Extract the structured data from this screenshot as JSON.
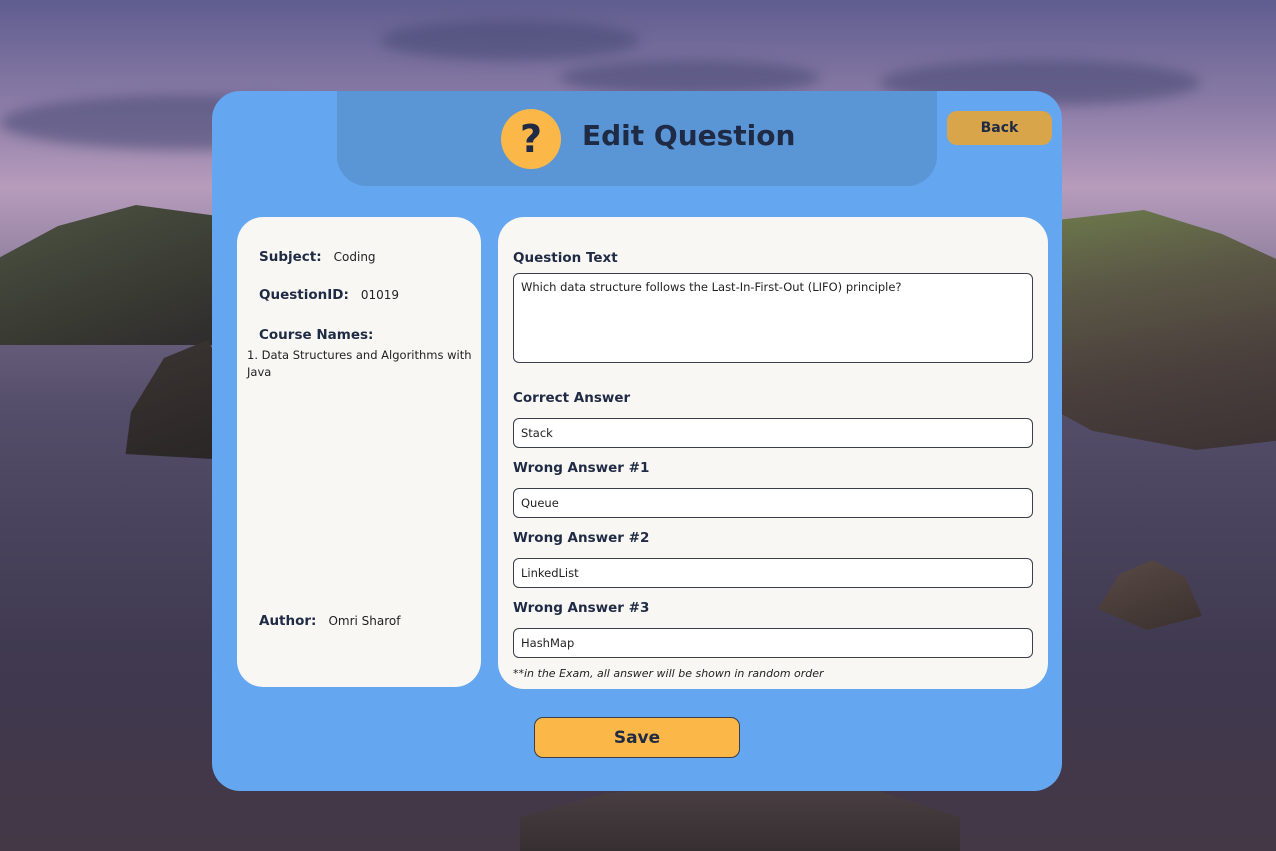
{
  "header": {
    "title": "Edit Question",
    "icon": "question-mark-icon",
    "icon_glyph": "?",
    "back_label": "Back"
  },
  "info": {
    "subject_label": "Subject:",
    "subject_value": "Coding",
    "question_id_label": "QuestionID:",
    "question_id_value": "01019",
    "course_names_label": "Course Names:",
    "course_names": [
      "1. Data Structures and Algorithms with Java"
    ],
    "author_label": "Author:",
    "author_value": "Omri Sharof"
  },
  "form": {
    "question_text_label": "Question Text",
    "question_text": "Which data structure follows the Last-In-First-Out (LIFO) principle?",
    "correct_answer_label": "Correct Answer",
    "correct_answer": "Stack",
    "wrong_answer_1_label": "Wrong Answer #1",
    "wrong_answer_1": "Queue",
    "wrong_answer_2_label": "Wrong Answer #2",
    "wrong_answer_2": "LinkedList",
    "wrong_answer_3_label": "Wrong Answer #3",
    "wrong_answer_3": "HashMap",
    "note": "**in the Exam, all answer will be shown in random order"
  },
  "actions": {
    "save_label": "Save"
  },
  "colors": {
    "panel": "#64a6ef",
    "header_tab": "#5a95d6",
    "accent": "#fbb848",
    "back_button": "#d9a54a",
    "card": "#f8f7f3",
    "text": "#1f2a44"
  }
}
